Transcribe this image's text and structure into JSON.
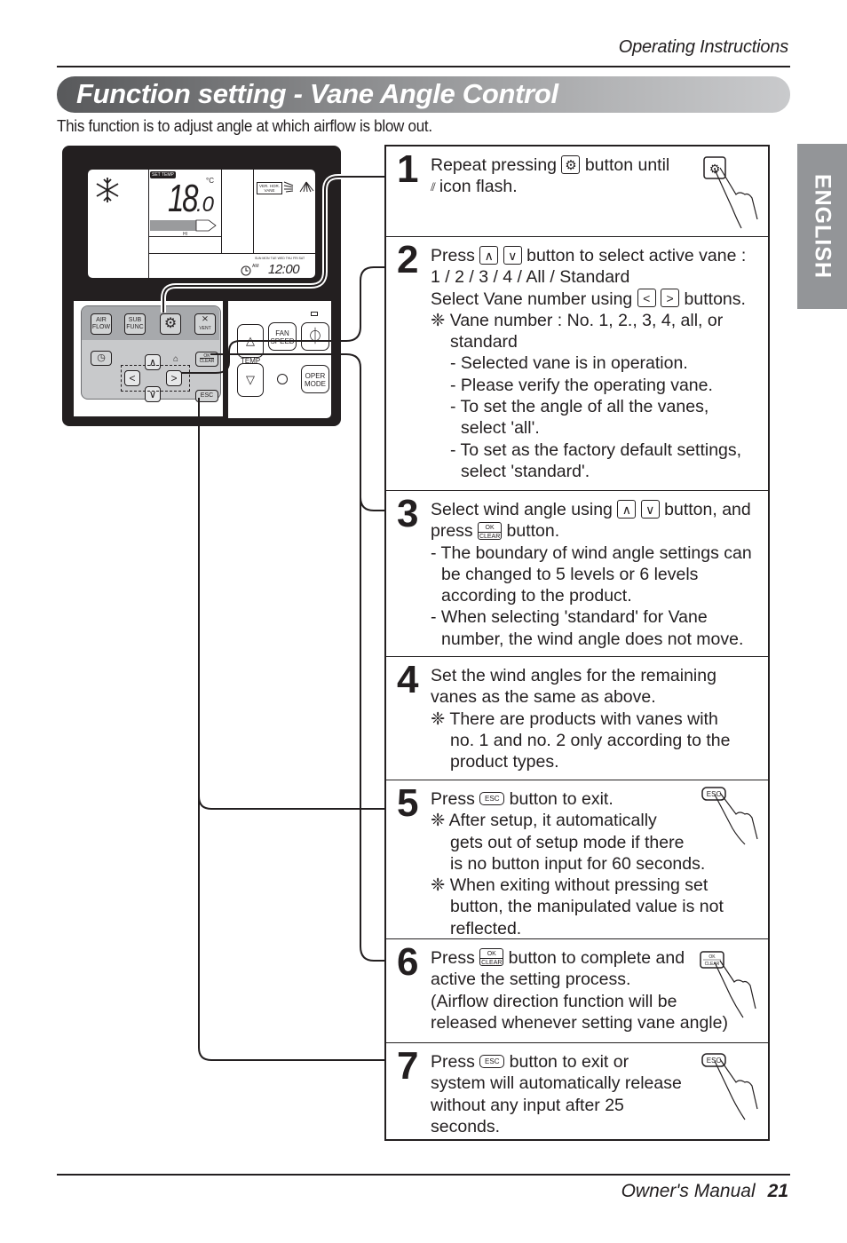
{
  "header": {
    "section_label": "Operating Instructions"
  },
  "title": "Function setting - Vane Angle Control",
  "intro": "This function is to adjust angle at which airflow is blow out.",
  "language_tab": "ENGLISH",
  "remote": {
    "lcd": {
      "set_temp_label": "SET TEMP",
      "temperature": "18",
      "temperature_decimal": ".0",
      "unit": "°C",
      "fan_level": "HI",
      "vane_label_line1": "VER. HOR.",
      "vane_label_line2": "VANE",
      "days": [
        "SUN",
        "MON",
        "TUE",
        "WED",
        "THU",
        "FRI",
        "SAT"
      ],
      "am_label": "AM",
      "clock": "12:00"
    },
    "buttons": {
      "air_flow": [
        "AIR",
        "FLOW"
      ],
      "sub_func": [
        "SUB",
        "FUNC"
      ],
      "vent": "VENT",
      "ok": "OK",
      "clear": "CLEAR",
      "esc": "ESC",
      "fan_speed": [
        "FAN",
        "SPEED"
      ],
      "temp": "TEMP",
      "oper_mode": [
        "OPER",
        "MODE"
      ]
    },
    "icons": {
      "mode": "snowflake-icon",
      "settings": "gear-icon",
      "timer": "clock-icon",
      "power": "power-icon"
    }
  },
  "steps": [
    {
      "number": "1",
      "lines": [
        {
          "before": "Repeat pressing ",
          "button": "gear",
          "after": " button until"
        },
        {
          "icon": "vane-swing-icon",
          "text": "icon flash."
        }
      ],
      "illustration": "hand-pressing-gear-button"
    },
    {
      "number": "2",
      "lines": [
        {
          "before": "Press ",
          "buttons": [
            "up",
            "down"
          ],
          "after": " button to select active vane :"
        },
        {
          "text": "1 / 2 / 3 / 4 / All / Standard"
        },
        {
          "before": "Select Vane number using ",
          "buttons": [
            "left",
            "right"
          ],
          "after": " buttons."
        },
        {
          "text": "❈ Vane number : No. 1, 2., 3, 4, all, or"
        },
        {
          "text": "standard"
        },
        {
          "text": "- Selected vane is in operation."
        },
        {
          "text": "- Please verify the operating vane."
        },
        {
          "text": "- To set the angle of all the vanes,"
        },
        {
          "text": "select 'all'."
        },
        {
          "text": "- To set as the factory default settings,"
        },
        {
          "text": "select 'standard'."
        }
      ]
    },
    {
      "number": "3",
      "lines": [
        {
          "before": "Select wind angle using ",
          "buttons": [
            "up",
            "down"
          ],
          "after": " button, and"
        },
        {
          "before": "press ",
          "button": "ok-clear",
          "after": " button."
        },
        {
          "text": "- The boundary of wind angle settings can"
        },
        {
          "text": "be changed to 5 levels or 6 levels"
        },
        {
          "text": "according to the product."
        },
        {
          "text": "- When selecting 'standard' for Vane"
        },
        {
          "text": "number, the wind angle does not move."
        }
      ]
    },
    {
      "number": "4",
      "lines": [
        {
          "text": "Set the wind angles for the remaining"
        },
        {
          "text": "vanes as the same as above."
        },
        {
          "text": "❈ There are products with vanes with"
        },
        {
          "text": "no. 1 and no. 2 only according to the"
        },
        {
          "text": "product types."
        }
      ]
    },
    {
      "number": "5",
      "lines": [
        {
          "before": "Press ",
          "button": "esc",
          "after": " button to exit."
        },
        {
          "text": "❈ After setup, it automatically"
        },
        {
          "text": "gets out of setup mode if there"
        },
        {
          "text": "is no button input for 60 seconds."
        },
        {
          "text": "❈ When exiting without pressing set"
        },
        {
          "text": "button, the manipulated value is not"
        },
        {
          "text": "reflected."
        }
      ],
      "illustration": "hand-pressing-esc-button"
    },
    {
      "number": "6",
      "lines": [
        {
          "before": "Press ",
          "button": "ok-clear",
          "after": " button to complete and"
        },
        {
          "text": "active the setting process."
        },
        {
          "text": "(Airflow direction function will be"
        },
        {
          "text": "released whenever setting vane angle)"
        }
      ],
      "illustration": "hand-pressing-ok-clear-button"
    },
    {
      "number": "7",
      "lines": [
        {
          "before": "Press ",
          "button": "esc",
          "after": " button to exit or"
        },
        {
          "text": "system will automatically release"
        },
        {
          "text": "without any input after 25"
        },
        {
          "text": "seconds."
        }
      ],
      "illustration": "hand-pressing-esc-button"
    }
  ],
  "footer": {
    "manual_label": "Owner's Manual",
    "page_number": "21"
  }
}
